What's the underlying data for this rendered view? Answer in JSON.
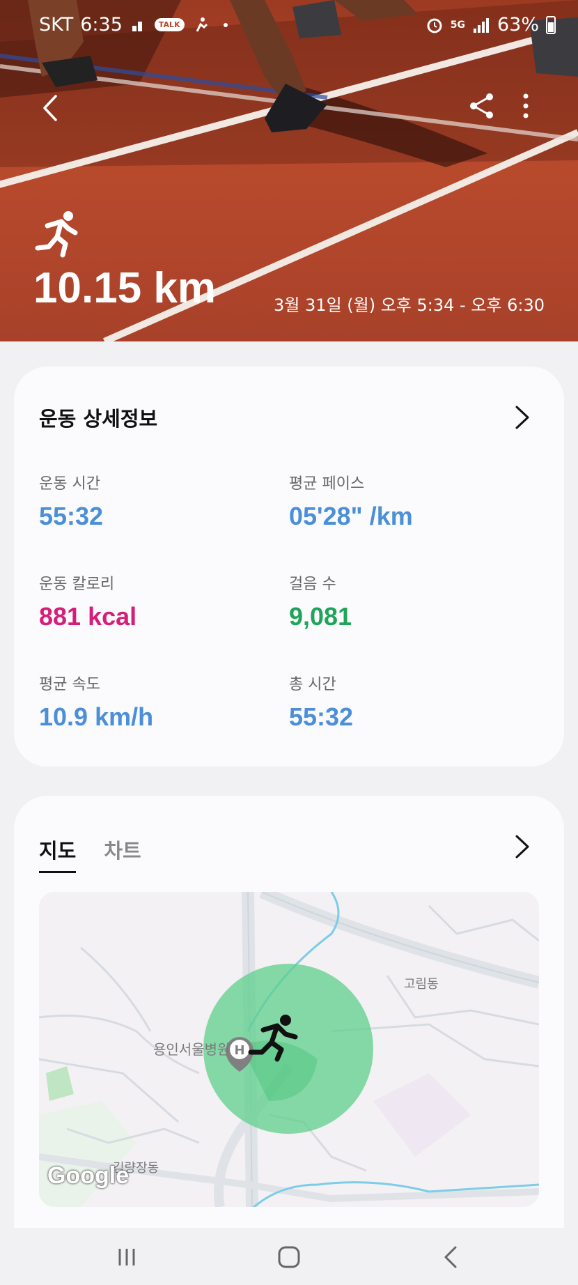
{
  "status_bar": {
    "carrier": "SKT",
    "time": "6:35",
    "talk": "TALK",
    "network": "5G",
    "battery": "63%"
  },
  "hero": {
    "distance": "10.15 km",
    "datetime": "3월 31일 (월) 오후 5:34 - 오후 6:30"
  },
  "details": {
    "title": "운동 상세정보",
    "metrics": [
      {
        "label": "운동 시간",
        "value": "55:32",
        "color": "#4b8fd8"
      },
      {
        "label": "평균 페이스",
        "value": "05'28\" /km",
        "color": "#4b8fd8"
      },
      {
        "label": "운동 칼로리",
        "value": "881 kcal",
        "color": "#d51e78"
      },
      {
        "label": "걸음 수",
        "value": "9,081",
        "color": "#1fa45a"
      },
      {
        "label": "평균 속도",
        "value": "10.9 km/h",
        "color": "#4b8fd8"
      },
      {
        "label": "총 시간",
        "value": "55:32",
        "color": "#4b8fd8"
      }
    ]
  },
  "map_card": {
    "tabs": [
      "지도",
      "차트"
    ],
    "active_tab": "지도",
    "labels": {
      "hospital": "용인서울병원",
      "district1": "고림동",
      "district2": "김량장동",
      "google": "Google"
    }
  },
  "icons": {
    "back": "back-arrow-icon",
    "share": "share-icon",
    "more": "more-vertical-icon",
    "run": "running-person-icon",
    "chevron": "chevron-right-icon"
  }
}
